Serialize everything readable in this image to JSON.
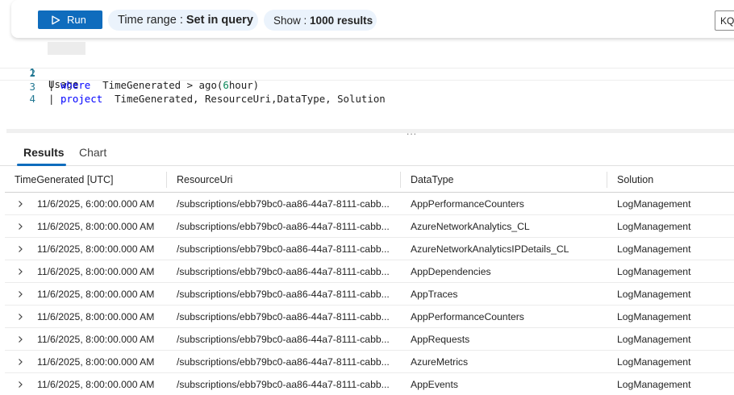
{
  "toolbar": {
    "run_label": "Run",
    "time_range_label": "Time range :",
    "time_range_value": "Set in query",
    "show_label": "Show :",
    "show_value": "1000 results",
    "mode_label": "KQ"
  },
  "editor": {
    "lines": [
      {
        "num": "1",
        "text": "Usage"
      },
      {
        "num": "2",
        "text": "| where  TimeGenerated > ago(6hour)"
      },
      {
        "num": "3",
        "text": "| project  TimeGenerated, ResourceUri,DataType, Solution"
      },
      {
        "num": "4",
        "text": ""
      }
    ]
  },
  "splitter_glyph": "...",
  "tabs": [
    {
      "label": "Results",
      "active": true
    },
    {
      "label": "Chart",
      "active": false
    }
  ],
  "table": {
    "columns": [
      "TimeGenerated [UTC]",
      "ResourceUri",
      "DataType",
      "Solution"
    ],
    "rows": [
      {
        "time": "11/6/2025, 6:00:00.000 AM",
        "uri": "/subscriptions/ebb79bc0-aa86-44a7-8111-cabb...",
        "type": "AppPerformanceCounters",
        "solution": "LogManagement"
      },
      {
        "time": "11/6/2025, 8:00:00.000 AM",
        "uri": "/subscriptions/ebb79bc0-aa86-44a7-8111-cabb...",
        "type": "AzureNetworkAnalytics_CL",
        "solution": "LogManagement"
      },
      {
        "time": "11/6/2025, 8:00:00.000 AM",
        "uri": "/subscriptions/ebb79bc0-aa86-44a7-8111-cabb...",
        "type": "AzureNetworkAnalyticsIPDetails_CL",
        "solution": "LogManagement"
      },
      {
        "time": "11/6/2025, 8:00:00.000 AM",
        "uri": "/subscriptions/ebb79bc0-aa86-44a7-8111-cabb...",
        "type": "AppDependencies",
        "solution": "LogManagement"
      },
      {
        "time": "11/6/2025, 8:00:00.000 AM",
        "uri": "/subscriptions/ebb79bc0-aa86-44a7-8111-cabb...",
        "type": "AppTraces",
        "solution": "LogManagement"
      },
      {
        "time": "11/6/2025, 8:00:00.000 AM",
        "uri": "/subscriptions/ebb79bc0-aa86-44a7-8111-cabb...",
        "type": "AppPerformanceCounters",
        "solution": "LogManagement"
      },
      {
        "time": "11/6/2025, 8:00:00.000 AM",
        "uri": "/subscriptions/ebb79bc0-aa86-44a7-8111-cabb...",
        "type": "AppRequests",
        "solution": "LogManagement"
      },
      {
        "time": "11/6/2025, 8:00:00.000 AM",
        "uri": "/subscriptions/ebb79bc0-aa86-44a7-8111-cabb...",
        "type": "AzureMetrics",
        "solution": "LogManagement"
      },
      {
        "time": "11/6/2025, 8:00:00.000 AM",
        "uri": "/subscriptions/ebb79bc0-aa86-44a7-8111-cabb...",
        "type": "AppEvents",
        "solution": "LogManagement"
      }
    ]
  },
  "icons": {
    "run": "play-icon",
    "expand": "chevron-right-icon"
  },
  "colors": {
    "accent": "#0f6cbd",
    "pill_bg": "#ebf3fc",
    "keyword": "#0000ff",
    "line_number": "#237893"
  }
}
